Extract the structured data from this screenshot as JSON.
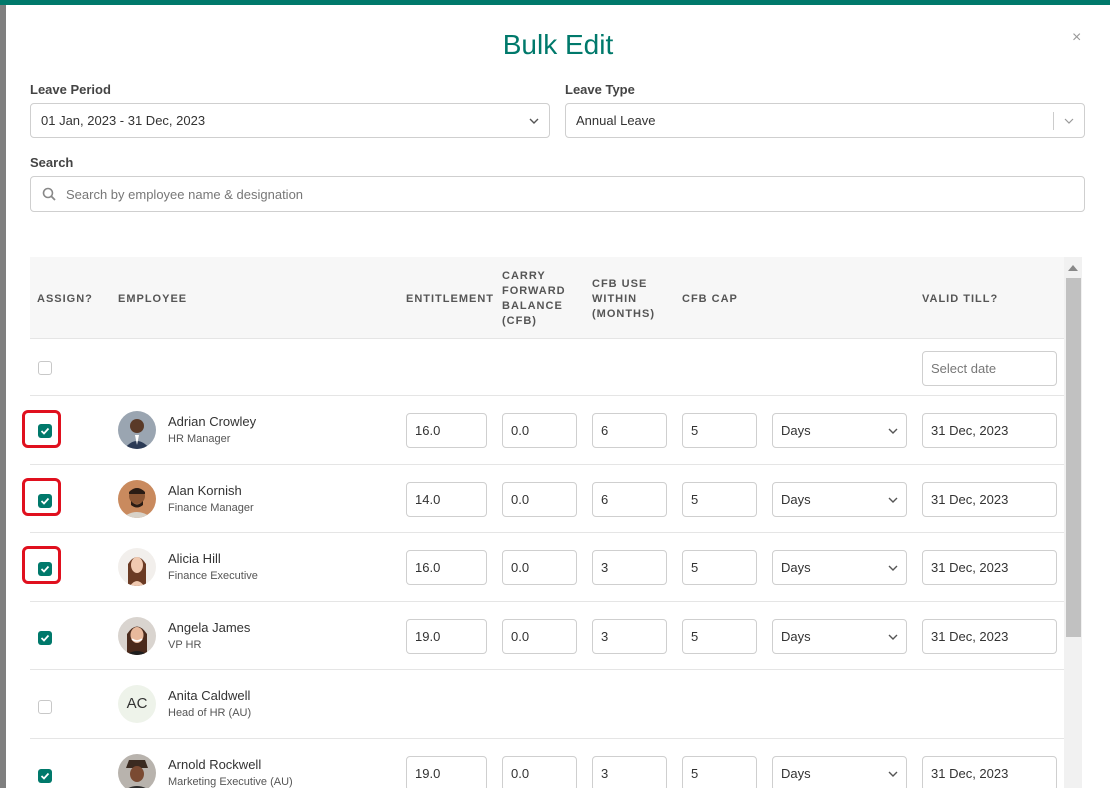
{
  "modal": {
    "title": "Bulk Edit",
    "close": "×"
  },
  "leave_period": {
    "label": "Leave Period",
    "value": "01 Jan, 2023 - 31 Dec, 2023"
  },
  "leave_type": {
    "label": "Leave Type",
    "value": "Annual Leave"
  },
  "search": {
    "label": "Search",
    "placeholder": "Search by employee name & designation"
  },
  "table": {
    "headers": {
      "assign": "ASSIGN?",
      "employee": "EMPLOYEE",
      "entitlement": "ENTITLEMENT",
      "cfb_1": "CARRY",
      "cfb_2": "FORWARD",
      "cfb_3": "BALANCE",
      "cfb_4": "(CFB)",
      "use_1": "CFB USE",
      "use_2": "WITHIN",
      "use_3": "(MONTHS)",
      "cap": "CFB CAP",
      "valid": "VALID TILL?"
    },
    "select_all_date_placeholder": "Select date",
    "rows": [
      {
        "checked": true,
        "highlighted": true,
        "name": "Adrian Crowley",
        "title": "HR Manager",
        "avatar": "photo",
        "entitlement": "16.0",
        "cfb": "0.0",
        "months": "6",
        "cap": "5",
        "unit": "Days",
        "valid": "31 Dec, 2023"
      },
      {
        "checked": true,
        "highlighted": true,
        "name": "Alan Kornish",
        "title": "Finance Manager",
        "avatar": "photo",
        "entitlement": "14.0",
        "cfb": "0.0",
        "months": "6",
        "cap": "5",
        "unit": "Days",
        "valid": "31 Dec, 2023"
      },
      {
        "checked": true,
        "highlighted": true,
        "name": "Alicia Hill",
        "title": "Finance Executive",
        "avatar": "photo",
        "entitlement": "16.0",
        "cfb": "0.0",
        "months": "3",
        "cap": "5",
        "unit": "Days",
        "valid": "31 Dec, 2023"
      },
      {
        "checked": true,
        "highlighted": false,
        "name": "Angela James",
        "title": "VP HR",
        "avatar": "photo",
        "entitlement": "19.0",
        "cfb": "0.0",
        "months": "3",
        "cap": "5",
        "unit": "Days",
        "valid": "31 Dec, 2023"
      },
      {
        "checked": false,
        "highlighted": false,
        "name": "Anita Caldwell",
        "title": "Head of HR (AU)",
        "avatar": "AC"
      },
      {
        "checked": true,
        "highlighted": false,
        "name": "Arnold Rockwell",
        "title": "Marketing Executive (AU)",
        "avatar": "photo",
        "entitlement": "19.0",
        "cfb": "0.0",
        "months": "3",
        "cap": "5",
        "unit": "Days",
        "valid": "31 Dec, 2023"
      }
    ]
  },
  "colors": {
    "accent": "#00796b",
    "highlight": "#e0101e"
  }
}
